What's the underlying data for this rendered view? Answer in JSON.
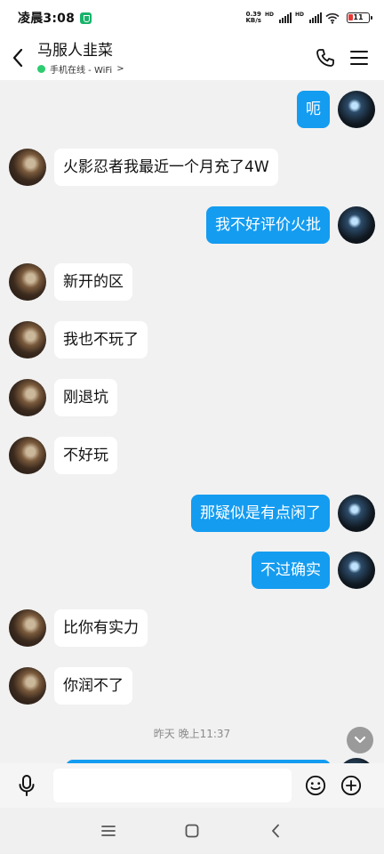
{
  "status_bar": {
    "time": "凌晨3:08",
    "net_speed_value": "0.39",
    "net_speed_unit": "KB/s",
    "hd1": "HD",
    "hd2": "HD",
    "battery": "11"
  },
  "header": {
    "title": "马服人韭菜",
    "subtitle": "手机在线 - WiFi",
    "subtitle_arrow": ">"
  },
  "messages": [
    {
      "side": "out",
      "text": "呃"
    },
    {
      "side": "in",
      "text": "火影忍者我最近一个月充了4W"
    },
    {
      "side": "out",
      "text": "我不好评价火批"
    },
    {
      "side": "in",
      "text": "新开的区"
    },
    {
      "side": "in",
      "text": "我也不玩了"
    },
    {
      "side": "in",
      "text": "刚退坑"
    },
    {
      "side": "in",
      "text": "不好玩"
    },
    {
      "side": "out",
      "text": "那疑似是有点闲了"
    },
    {
      "side": "out",
      "text": "不过确实"
    },
    {
      "side": "in",
      "text": "比你有实力"
    },
    {
      "side": "in",
      "text": "你润不了"
    }
  ],
  "timestamp": "昨天 晚上11:37",
  "input": {
    "value": "",
    "placeholder": ""
  },
  "colors": {
    "outgoing_bubble": "#149cf0",
    "incoming_bubble": "#ffffff",
    "online_dot": "#2ecc71",
    "chat_background": "#f1f1f1"
  },
  "icons": [
    "back-icon",
    "phone-icon",
    "menu-icon",
    "scroll-down-icon",
    "microphone-icon",
    "emoji-icon",
    "add-icon",
    "nav-menu-icon",
    "nav-home-icon",
    "nav-back-icon"
  ]
}
